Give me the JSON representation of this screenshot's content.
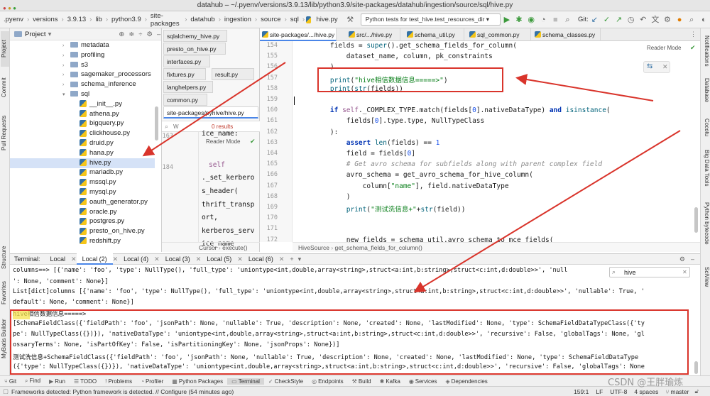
{
  "window": {
    "title": "datahub – ~/.pyenv/versions/3.9.13/lib/python3.9/site-packages/datahub/ingestion/source/sql/hive.py"
  },
  "breadcrumbs": [
    ".pyenv",
    "versions",
    "3.9.13",
    "lib",
    "python3.9",
    "site-packages",
    "datahub",
    "ingestion",
    "source",
    "sql",
    "hive.py"
  ],
  "run_config": "Python tests for test_hive.test_resources_dir",
  "git_label": "Git:",
  "project": {
    "header": "Project",
    "tree": [
      {
        "label": "metadata",
        "kind": "folder"
      },
      {
        "label": "profiling",
        "kind": "folder"
      },
      {
        "label": "s3",
        "kind": "folder"
      },
      {
        "label": "sagemaker_processors",
        "kind": "folder"
      },
      {
        "label": "schema_inference",
        "kind": "folder"
      },
      {
        "label": "sql",
        "kind": "folder"
      },
      {
        "label": "__init__.py",
        "kind": "file"
      },
      {
        "label": "athena.py",
        "kind": "file"
      },
      {
        "label": "bigquery.py",
        "kind": "file"
      },
      {
        "label": "clickhouse.py",
        "kind": "file"
      },
      {
        "label": "druid.py",
        "kind": "file"
      },
      {
        "label": "hana.py",
        "kind": "file"
      },
      {
        "label": "hive.py",
        "kind": "file"
      },
      {
        "label": "mariadb.py",
        "kind": "file"
      },
      {
        "label": "mssql.py",
        "kind": "file"
      },
      {
        "label": "mysql.py",
        "kind": "file"
      },
      {
        "label": "oauth_generator.py",
        "kind": "file"
      },
      {
        "label": "oracle.py",
        "kind": "file"
      },
      {
        "label": "postgres.py",
        "kind": "file"
      },
      {
        "label": "presto_on_hive.py",
        "kind": "file"
      },
      {
        "label": "redshift.py",
        "kind": "file"
      }
    ]
  },
  "mid_tabs": [
    "sqlalchemy_hive.py",
    "presto_on_hive.py",
    "interfaces.py",
    "fixtures.py",
    "result.py",
    "langhelpers.py",
    "common.py",
    "site-packages/pyhive/hive.py"
  ],
  "mid_search": {
    "placeholder": "W",
    "results": "0 results"
  },
  "mid_reader": "Reader Mode",
  "mid_lines": [
    {
      "n": "163",
      "text": "ice_name:"
    },
    {
      "n": "",
      "text": ""
    },
    {
      "n": "184",
      "text": "self"
    },
    {
      "n": "",
      "text": "._set_kerbero"
    },
    {
      "n": "",
      "text": "s_header("
    },
    {
      "n": "",
      "text": "thrift_transp"
    },
    {
      "n": "",
      "text": "ort,"
    },
    {
      "n": "",
      "text": "kerberos_serv"
    },
    {
      "n": "",
      "text": "ice_name"
    }
  ],
  "mid_status": {
    "a": "Cursor",
    "b": "execute()"
  },
  "editor_tabs": [
    "site-packages/.../hive.py",
    "src/.../hive.py",
    "schema_util.py",
    "sql_common.py",
    "schema_classes.py"
  ],
  "editor": {
    "reader_mode": "Reader Mode",
    "lines": [
      {
        "n": "154",
        "code": "    fields = super().get_schema_fields_for_column("
      },
      {
        "n": "155",
        "code": "        dataset_name, column, pk_constraints"
      },
      {
        "n": "156",
        "code": "    )"
      },
      {
        "n": "157",
        "code": "    print(\"hive相信数据信息=====>\")"
      },
      {
        "n": "158",
        "code": "    print(str(fields))"
      },
      {
        "n": "159",
        "code": ""
      },
      {
        "n": "160",
        "code": "    if self._COMPLEX_TYPE.match(fields[0].nativeDataType) and isinstance("
      },
      {
        "n": "161",
        "code": "        fields[0].type.type, NullTypeClass"
      },
      {
        "n": "162",
        "code": "    ):"
      },
      {
        "n": "163",
        "code": "        assert len(fields) == 1"
      },
      {
        "n": "164",
        "code": "        field = fields[0]"
      },
      {
        "n": "165",
        "code": "        # Get avro schema for subfields along with parent complex field"
      },
      {
        "n": "166",
        "code": "        avro_schema = get_avro_schema_for_hive_column("
      },
      {
        "n": "167",
        "code": "            column[\"name\"], field.nativeDataType"
      },
      {
        "n": "168",
        "code": "        )"
      },
      {
        "n": "169",
        "code": "        print(\"测试洗信息+\"+str(field))"
      },
      {
        "n": "170",
        "code": ""
      },
      {
        "n": "171",
        "code": ""
      },
      {
        "n": "172",
        "code": "        new_fields = schema_util.avro_schema_to_mce_fields("
      }
    ],
    "status": [
      "HiveSource",
      "get_schema_fields_for_column()"
    ]
  },
  "terminal": {
    "label": "Terminal:",
    "tabs": [
      "Local",
      "Local (2)",
      "Local (4)",
      "Local (3)",
      "Local (5)",
      "Local (6)"
    ],
    "search_value": "hive",
    "lines": [
      "columns==> [{'name': 'foo', 'type': NullType(), 'full_type': 'uniontype<int,double,array<string>,struct<a:int,b:string>,struct<c:int,d:double>>', 'null",
      "': None, 'comment': None}]",
      "List[dict]columns [{'name': 'foo', 'type': NullType(), 'full_type': 'uniontype<int,double,array<string>,struct<a:int,b:string>,struct<c:int,d:double>>', 'nullable': True, '",
      "default': None, 'comment': None}]",
      "hive相信数据信息=====>",
      "[SchemaFieldClass({'fieldPath': 'foo', 'jsonPath': None, 'nullable': True, 'description': None, 'created': None, 'lastModified': None, 'type': SchemaFieldDataTypeClass({'ty",
      "pe': NullTypeClass({})}), 'nativeDataType': 'uniontype<int,double,array<string>,struct<a:int,b:string>,struct<c:int,d:double>>', 'recursive': False, 'globalTags': None, 'gl",
      "ossaryTerms': None, 'isPartOfKey': False, 'isPartitioningKey': None, 'jsonProps': None})]",
      "测试洗信息+SchemaFieldClass({'fieldPath': 'foo', 'jsonPath': None, 'nullable': True, 'description': None, 'created': None, 'lastModified': None, 'type': SchemaFieldDataType",
      "({'type': NullTypeClass({})}), 'nativeDataType': 'uniontype<int,double,array<string>,struct<a:int,b:string>,struct<c:int,d:double>>', 'recursive': False, 'globalTags': None"
    ]
  },
  "bottom_tools": [
    "Git",
    "Find",
    "Run",
    "TODO",
    "Problems",
    "Profiler",
    "Python Packages",
    "Terminal",
    "CheckStyle",
    "Endpoints",
    "Build",
    "Kafka",
    "Services",
    "Dependencies"
  ],
  "status": {
    "left": "Frameworks detected: Python framework is detected. // Configure (54 minutes ago)",
    "position": "159:1",
    "line_sep": "LF",
    "encoding": "UTF-8",
    "indent": "4 spaces",
    "branch": "master"
  },
  "left_vtabs": [
    "Project",
    "Commit",
    "Pull Requests",
    "Structure",
    "Favorites",
    "MyBatis Builder"
  ],
  "right_vtabs": [
    "Notifications",
    "Database",
    "Cocotu",
    "Big Data Tools",
    "Python bytecode",
    "SciView"
  ],
  "watermark": "CSDN @王胖瑜炼",
  "colors": {
    "annotation_red": "#d9342b",
    "selection_blue": "#4a86e8",
    "keyword": "#0033b3",
    "string": "#067d17"
  }
}
